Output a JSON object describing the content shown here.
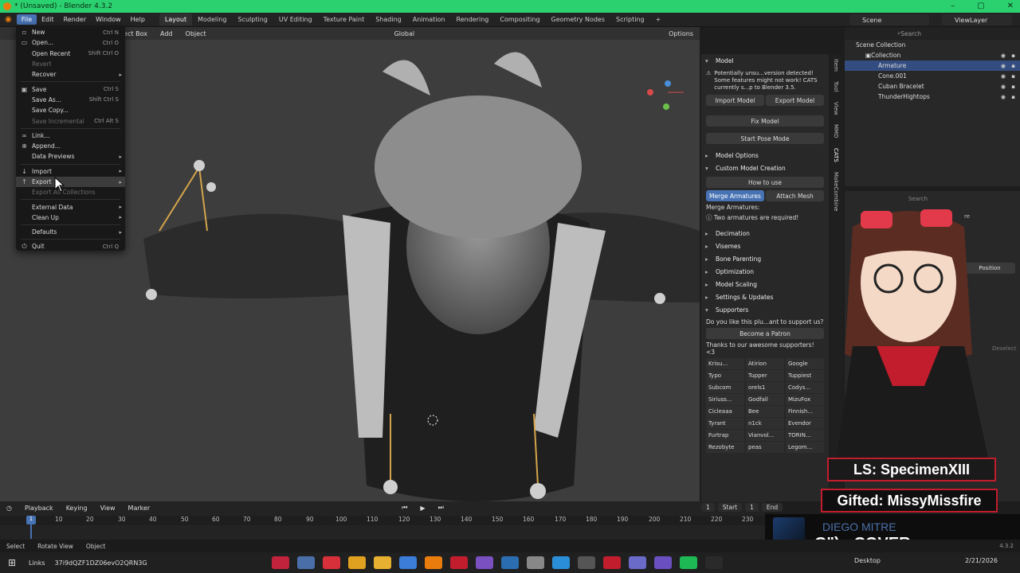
{
  "window": {
    "title": "* (Unsaved) - Blender 4.3.2",
    "controls": [
      "–",
      "▢",
      "✕"
    ]
  },
  "menubar": [
    "File",
    "Edit",
    "Render",
    "Window",
    "Help"
  ],
  "workspaces": [
    "Layout",
    "Modeling",
    "Sculpting",
    "UV Editing",
    "Texture Paint",
    "Shading",
    "Animation",
    "Rendering",
    "Compositing",
    "Geometry Nodes",
    "Scripting",
    "+"
  ],
  "scene": "Scene",
  "view_layer": "ViewLayer",
  "viewport_header": {
    "select_box": "elect Box",
    "add": "Add",
    "object": "Object",
    "orientation": "Global",
    "options": "Options"
  },
  "file_menu": {
    "items": [
      {
        "label": "New",
        "shortcut": "Ctrl N",
        "icon": "new-file-icon",
        "disabled": false
      },
      {
        "label": "Open...",
        "shortcut": "Ctrl O",
        "icon": "open-folder-icon",
        "disabled": false
      },
      {
        "label": "Open Recent",
        "shortcut": "Shift Ctrl O",
        "disabled": false
      },
      {
        "label": "Revert",
        "shortcut": "",
        "disabled": true
      },
      {
        "label": "Recover",
        "shortcut": "",
        "submenu": true,
        "disabled": false
      },
      {
        "label": "Save",
        "shortcut": "Ctrl S",
        "icon": "save-icon",
        "disabled": false
      },
      {
        "label": "Save As...",
        "shortcut": "Shift Ctrl S",
        "disabled": false
      },
      {
        "label": "Save Copy...",
        "shortcut": "",
        "disabled": false
      },
      {
        "label": "Save Incremental",
        "shortcut": "Ctrl Alt S",
        "disabled": true
      },
      {
        "label": "Link...",
        "shortcut": "",
        "icon": "link-icon",
        "disabled": false
      },
      {
        "label": "Append...",
        "shortcut": "",
        "icon": "append-icon",
        "disabled": false
      },
      {
        "label": "Data Previews",
        "shortcut": "",
        "submenu": true,
        "disabled": false
      },
      {
        "label": "Import",
        "shortcut": "",
        "submenu": true,
        "icon": "import-icon",
        "disabled": false
      },
      {
        "label": "Export",
        "shortcut": "",
        "submenu": true,
        "icon": "export-icon",
        "disabled": false,
        "highlight": true
      },
      {
        "label": "Export All Collections",
        "shortcut": "",
        "disabled": true
      },
      {
        "label": "External Data",
        "shortcut": "",
        "submenu": true,
        "disabled": false
      },
      {
        "label": "Clean Up",
        "shortcut": "",
        "submenu": true,
        "disabled": false
      },
      {
        "label": "Defaults",
        "shortcut": "",
        "submenu": true,
        "disabled": false
      },
      {
        "label": "Quit",
        "shortcut": "Ctrl Q",
        "icon": "quit-icon",
        "disabled": false
      }
    ]
  },
  "npanel": {
    "model_header": "Model",
    "warning": "Potentially unsu...version detected! Some features might not work! CATS currently s...p to Blender 3.5.",
    "import_model": "Import Model",
    "export_model": "Export Model",
    "fix_model": "Fix Model",
    "start_pose": "Start Pose Mode",
    "model_options": "Model Options",
    "custom_model_creation": "Custom Model Creation",
    "how_to_use": "How to use",
    "merge_armatures": "Merge Armatures",
    "attach_mesh": "Attach Mesh",
    "merge_label": "Merge Armatures:",
    "merge_warning": "Two armatures are required!",
    "sections": [
      "Decimation",
      "Visemes",
      "Bone Parenting",
      "Optimization",
      "Model Scaling",
      "Settings & Updates",
      "Supporters"
    ],
    "support_question": "Do you like this plu...ant to support us?",
    "become_patron": "Become a Patron",
    "thanks": "Thanks to our awesome supporters! <3",
    "supporters": [
      "Krisu...",
      "Atirion",
      "Google",
      "Typo",
      "Tupper",
      "Tuppiest",
      "Subcom",
      "orels1",
      "Codys...",
      "Siriuss...",
      "Godfall",
      "MizuFox",
      "Cicleaaa",
      "Bee",
      "Finnish...",
      "Tyrant",
      "n1ck",
      "Evendor",
      "Furtrap",
      "Vianvol...",
      "TORIN...",
      "Rezobyte",
      "peas",
      "Legom..."
    ]
  },
  "side_tabs": [
    "Item",
    "Tool",
    "View",
    "MMD",
    "CATS",
    "MakeCombine"
  ],
  "outliner": {
    "search_placeholder": "Search",
    "scene_collection": "Scene Collection",
    "collection": "Collection",
    "objects": [
      "Armature",
      "Cone.001",
      "Cuban Bracelet",
      "ThunderHightops"
    ]
  },
  "props_partial": {
    "search_placeholder": "Search",
    "position_label": "Position",
    "deselect": "Deselect",
    "name_fragment": "re"
  },
  "stream": {
    "ls": "LS: SpecimenXIII",
    "gifted": "Gifted: MissyMissfire",
    "artist": "DIEGO MITRE",
    "track": "G\") - COVER"
  },
  "timeline": {
    "menus": [
      "Playback",
      "Keying",
      "View",
      "Marker"
    ],
    "current_frame": "1",
    "ticks": [
      "10",
      "20",
      "30",
      "40",
      "50",
      "60",
      "70",
      "80",
      "90",
      "100",
      "110",
      "120",
      "130",
      "140",
      "150",
      "160",
      "170",
      "180",
      "190",
      "200",
      "210",
      "220",
      "230"
    ],
    "frame_field": "1",
    "start_label": "Start",
    "start_value": "1",
    "end_label": "End"
  },
  "status": {
    "select": "Select",
    "rotate": "Rotate View",
    "object": "Object",
    "version": "4.3.2"
  },
  "taskbar": {
    "links": "Links",
    "address": "37i9dQZF1DZ06evO2QRN3G",
    "desktop": "Desktop",
    "date": "2/21/2026"
  }
}
